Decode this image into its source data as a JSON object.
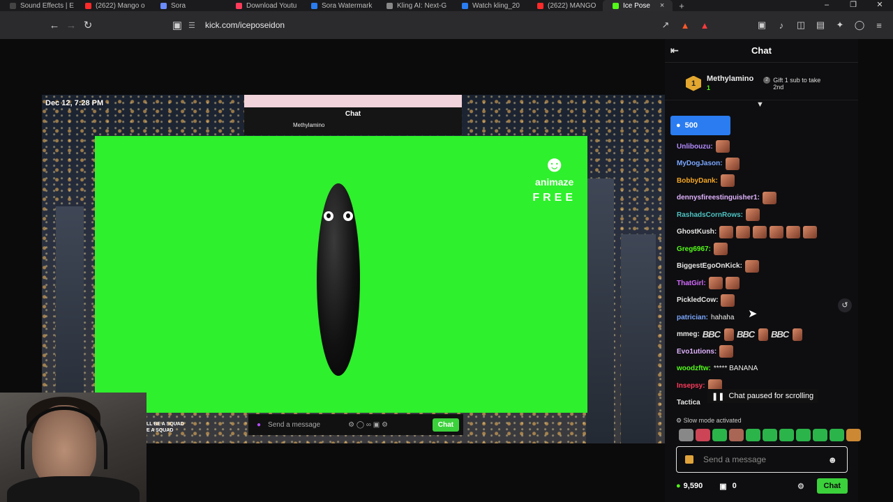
{
  "browser": {
    "tabs": [
      {
        "label": "Sound Effects | E",
        "color": "#444444"
      },
      {
        "label": "(2622) Mango o",
        "color": "#ff2a2a"
      },
      {
        "label": "Sora",
        "color": "#6b8cff"
      },
      {
        "label": "Download Youtu",
        "color": "#ff3b5c"
      },
      {
        "label": "Sora Watermark",
        "color": "#2a7cf0"
      },
      {
        "label": "Kling AI: Next-G",
        "color": "#888888"
      },
      {
        "label": "Watch kling_20",
        "color": "#2a7cf0"
      },
      {
        "label": "(2622) MANGO",
        "color": "#ff2a2a"
      },
      {
        "label": "Ice Pose",
        "color": "#53fc18"
      }
    ],
    "url": "kick.com/iceposeidon"
  },
  "stream": {
    "timestamp": "Dec 12, 7:28 PM",
    "mini_window_title": "Chat",
    "mini_user": "Methylamino",
    "logo_brand": "animaze",
    "logo_free": "FREE",
    "inner_input_placeholder": "Send a message",
    "inner_chat_button": "Chat",
    "overlay_text": "LL BE A SQUAD\nE A SQUAD"
  },
  "chat": {
    "title": "Chat",
    "pinned": {
      "rank": "1",
      "username": "Methylamino",
      "count": "1",
      "gift_num": "2",
      "gift_text": "Gift 1 sub to take 2nd"
    },
    "goal_value": "500",
    "messages": [
      {
        "user": "Unlibouzu:",
        "color": "#b58cff",
        "text": "",
        "emotes": 1
      },
      {
        "user": "MyDogJason:",
        "color": "#7aa7ff",
        "text": "",
        "emotes": 1
      },
      {
        "user": "BobbyDank:",
        "color": "#f5a623",
        "text": "",
        "emotes": 1
      },
      {
        "user": "dennysfireestinguisher1:",
        "color": "#e0b3ff",
        "text": "",
        "emotes": 1
      },
      {
        "user": "RashadsCornRows:",
        "color": "#4fc3c3",
        "text": "",
        "emotes": 1
      },
      {
        "user": "GhostKush:",
        "color": "#e6e6e6",
        "text": "",
        "emotes": 6
      },
      {
        "user": "Greg6967:",
        "color": "#53fc18",
        "text": "",
        "emotes": 1
      },
      {
        "user": "BiggestEgoOnKick:",
        "color": "#e6e6e6",
        "text": "",
        "emotes": 1
      },
      {
        "user": "ThatGirl:",
        "color": "#d56bff",
        "text": "",
        "emotes": 2
      },
      {
        "user": "PickledCow:",
        "color": "#e6e6e6",
        "text": "",
        "emotes": 1
      },
      {
        "user": "patrician:",
        "color": "#7aa7ff",
        "text": "hahaha",
        "emotes": 0
      },
      {
        "user": "mmeg:",
        "color": "#e6e6e6",
        "text": "",
        "bbc": true
      },
      {
        "user": "Evo1utions:",
        "color": "#e0b3ff",
        "text": "",
        "emotes": 1
      },
      {
        "user": "woodzftw:",
        "color": "#53fc18",
        "text": "***** BANANA",
        "emotes": 0
      },
      {
        "user": "Insepsy:",
        "color": "#ff3b5c",
        "text": "",
        "emotes": 1
      },
      {
        "user": "Tactica",
        "color": "#e6e6e6",
        "text": "",
        "emotes": 0
      }
    ],
    "bbc_label": "BBC",
    "paused_text": "Chat paused for scrolling",
    "slow_mode": "Slow mode activated",
    "input_placeholder": "Send a message",
    "points": "9,590",
    "gifts_count": "0",
    "chat_button": "Chat"
  }
}
